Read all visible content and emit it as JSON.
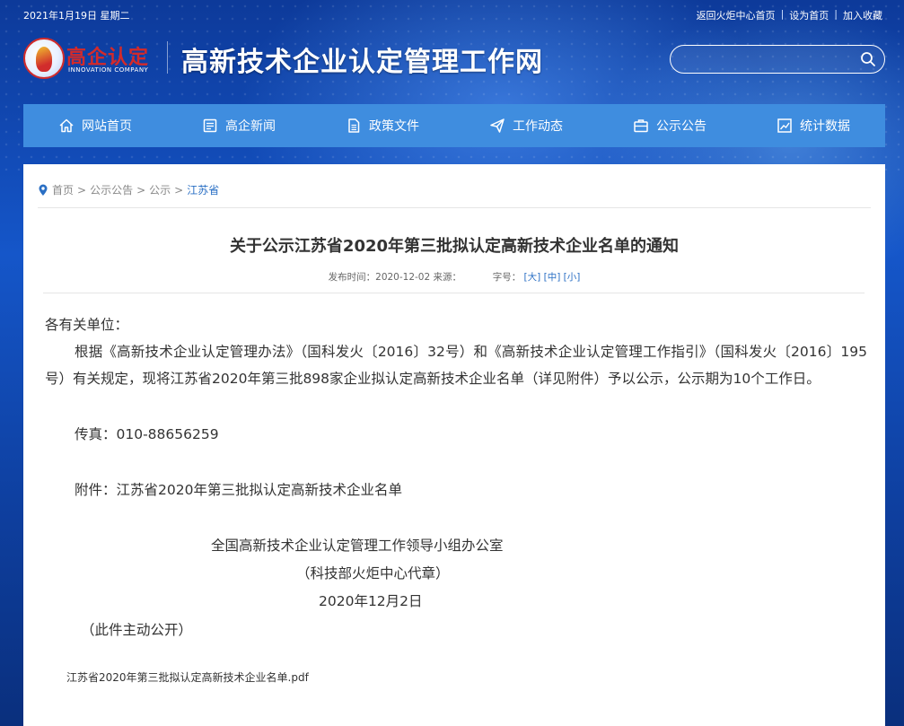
{
  "topbar": {
    "date": "2021年1月19日 星期二",
    "links": [
      "返回火炬中心首页",
      "设为首页",
      "加入收藏"
    ]
  },
  "header": {
    "logo_cn": "高企认定",
    "logo_en": "INNOVATION COMPANY",
    "site_title": "高新技术企业认定管理工作网",
    "search_placeholder": ""
  },
  "nav": [
    {
      "label": "网站首页",
      "icon": "home-icon"
    },
    {
      "label": "高企新闻",
      "icon": "news-icon"
    },
    {
      "label": "政策文件",
      "icon": "document-icon"
    },
    {
      "label": "工作动态",
      "icon": "paper-plane-icon"
    },
    {
      "label": "公示公告",
      "icon": "briefcase-icon"
    },
    {
      "label": "统计数据",
      "icon": "chart-icon"
    }
  ],
  "breadcrumb": {
    "items": [
      "首页",
      "公示公告",
      "公示"
    ],
    "current": "江苏省",
    "sep": ">"
  },
  "article": {
    "title": "关于公示江苏省2020年第三批拟认定高新技术企业名单的通知",
    "meta_publish_label": "发布时间：",
    "meta_publish_date": "2020-12-02",
    "meta_source_label": "来源：",
    "meta_fontsize_label": "字号：",
    "fontsize_large": "[大]",
    "fontsize_medium": "[中]",
    "fontsize_small": "[小]",
    "greeting": "各有关单位：",
    "main": "根据《高新技术企业认定管理办法》（国科发火〔2016〕32号）和《高新技术企业认定管理工作指引》（国科发火〔2016〕195号）有关规定，现将江苏省2020年第三批898家企业拟认定高新技术企业名单（详见附件）予以公示，公示期为10个工作日。",
    "fax": "传真：010-88656259",
    "attachment": "附件：江苏省2020年第三批拟认定高新技术企业名单",
    "sign_office": "全国高新技术企业认定管理工作领导小组办公室",
    "sign_agent": "（科技部火炬中心代章）",
    "sign_date": "2020年12月2日",
    "open_note": "（此件主动公开）",
    "file_link": "江苏省2020年第三批拟认定高新技术企业名单.pdf"
  }
}
